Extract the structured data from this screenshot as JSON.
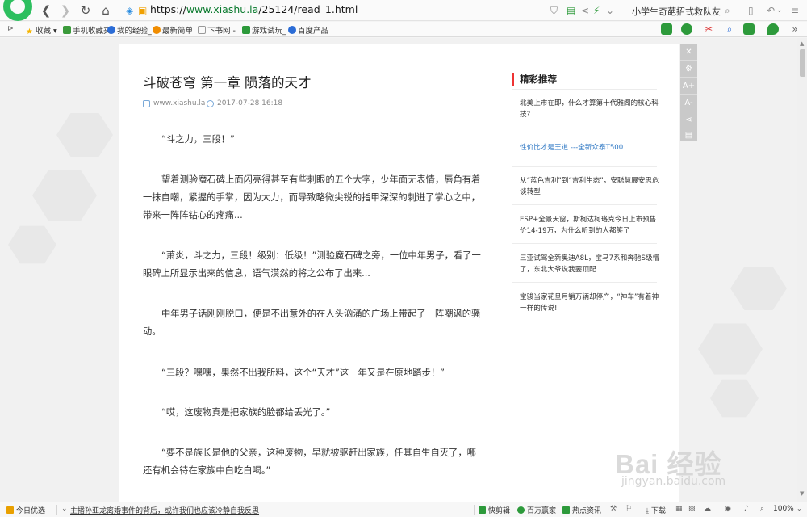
{
  "browser": {
    "url_prefix": "https://",
    "url_host": "www.xiashu.la",
    "url_path": "/25124/read_1.html",
    "search_query": "小学生奇葩招式救队友"
  },
  "bookmarks": {
    "items": [
      {
        "label": "收藏",
        "icon": "star-icon",
        "color": "#f5b400"
      },
      {
        "label": "手机收藏夹",
        "icon": "phone-icon",
        "color": "#3a9a3a"
      },
      {
        "label": "我的经验_",
        "icon": "paw-icon",
        "color": "#2b6cd6"
      },
      {
        "label": "最新简单",
        "icon": "fire-icon",
        "color": "#f08c00"
      },
      {
        "label": "下书网 -",
        "icon": "book-icon",
        "color": "#888888"
      },
      {
        "label": "游戏试玩_",
        "icon": "game-icon",
        "color": "#2d9a3b"
      },
      {
        "label": "百度产品",
        "icon": "paw-icon",
        "color": "#2b6cd6"
      }
    ]
  },
  "article": {
    "title": "斗破苍穹 第一章 陨落的天才",
    "site": "www.xiashu.la",
    "date": "2017-07-28 16:18",
    "paragraphs": [
      "“斗之力，三段！”",
      "望着测验魔石碑上面闪亮得甚至有些刺眼的五个大字，少年面无表情，唇角有着一抹自嘲，紧握的手掌，因为大力，而导致略微尖锐的指甲深深的刺进了掌心之中，带来一阵阵钻心的疼痛...",
      "“萧炎，斗之力，三段！级别：低级！”测验魔石碑之旁，一位中年男子，看了一眼碑上所显示出来的信息，语气漠然的将之公布了出来...",
      "中年男子话刚刚脱口，便是不出意外的在人头汹涌的广场上带起了一阵嘲讽的骚动。",
      "“三段？嘿嘿，果然不出我所料，这个“天才”这一年又是在原地踏步！”",
      "“哎，这废物真是把家族的脸都给丢光了。”",
      "“要不是族长是他的父亲，这种废物，早就被驱赶出家族，任其自生自灭了，哪还有机会待在家族中白吃白喝。”"
    ]
  },
  "sidebar": {
    "heading": "精彩推荐",
    "items": [
      {
        "text": "北美上市在即，什么才算第十代雅阁的核心科技?",
        "highlight": false
      },
      {
        "text": "性价比才是王道 ---全新众泰T500",
        "highlight": true
      },
      {
        "text": "从“蓝色吉利”到“吉利生态”，安聪慧展安思危谈转型",
        "highlight": false
      },
      {
        "text": "ESP+全景天窗，斯柯达柯珞克今日上市预售价14-19万，为什么听到的人都笑了",
        "highlight": false
      },
      {
        "text": "三亚试驾全新奥迪A8L，宝马7系和奔驰S级懵了，东北大爷说我要顶配",
        "highlight": false
      },
      {
        "text": "宝骏当家花旦月销万辆却停产，“神车”有着神一样的传说!",
        "highlight": false
      }
    ]
  },
  "tools": {
    "close": "✕",
    "settings": "⚙",
    "font_up": "A+",
    "font_down": "A-",
    "share": "share",
    "save": "save"
  },
  "statusbar": {
    "today": "今日优选",
    "news": "主播孙亚龙离婚事件的背后，或许我们也应该冷静自我反思",
    "quick_clip": "快剪辑",
    "million": "百万赢家",
    "hot_news": "热点资讯",
    "download": "下载",
    "zoom": "100%"
  },
  "watermark": {
    "brand": "Bai 经验",
    "sub": "jingyan.baidu.com"
  }
}
